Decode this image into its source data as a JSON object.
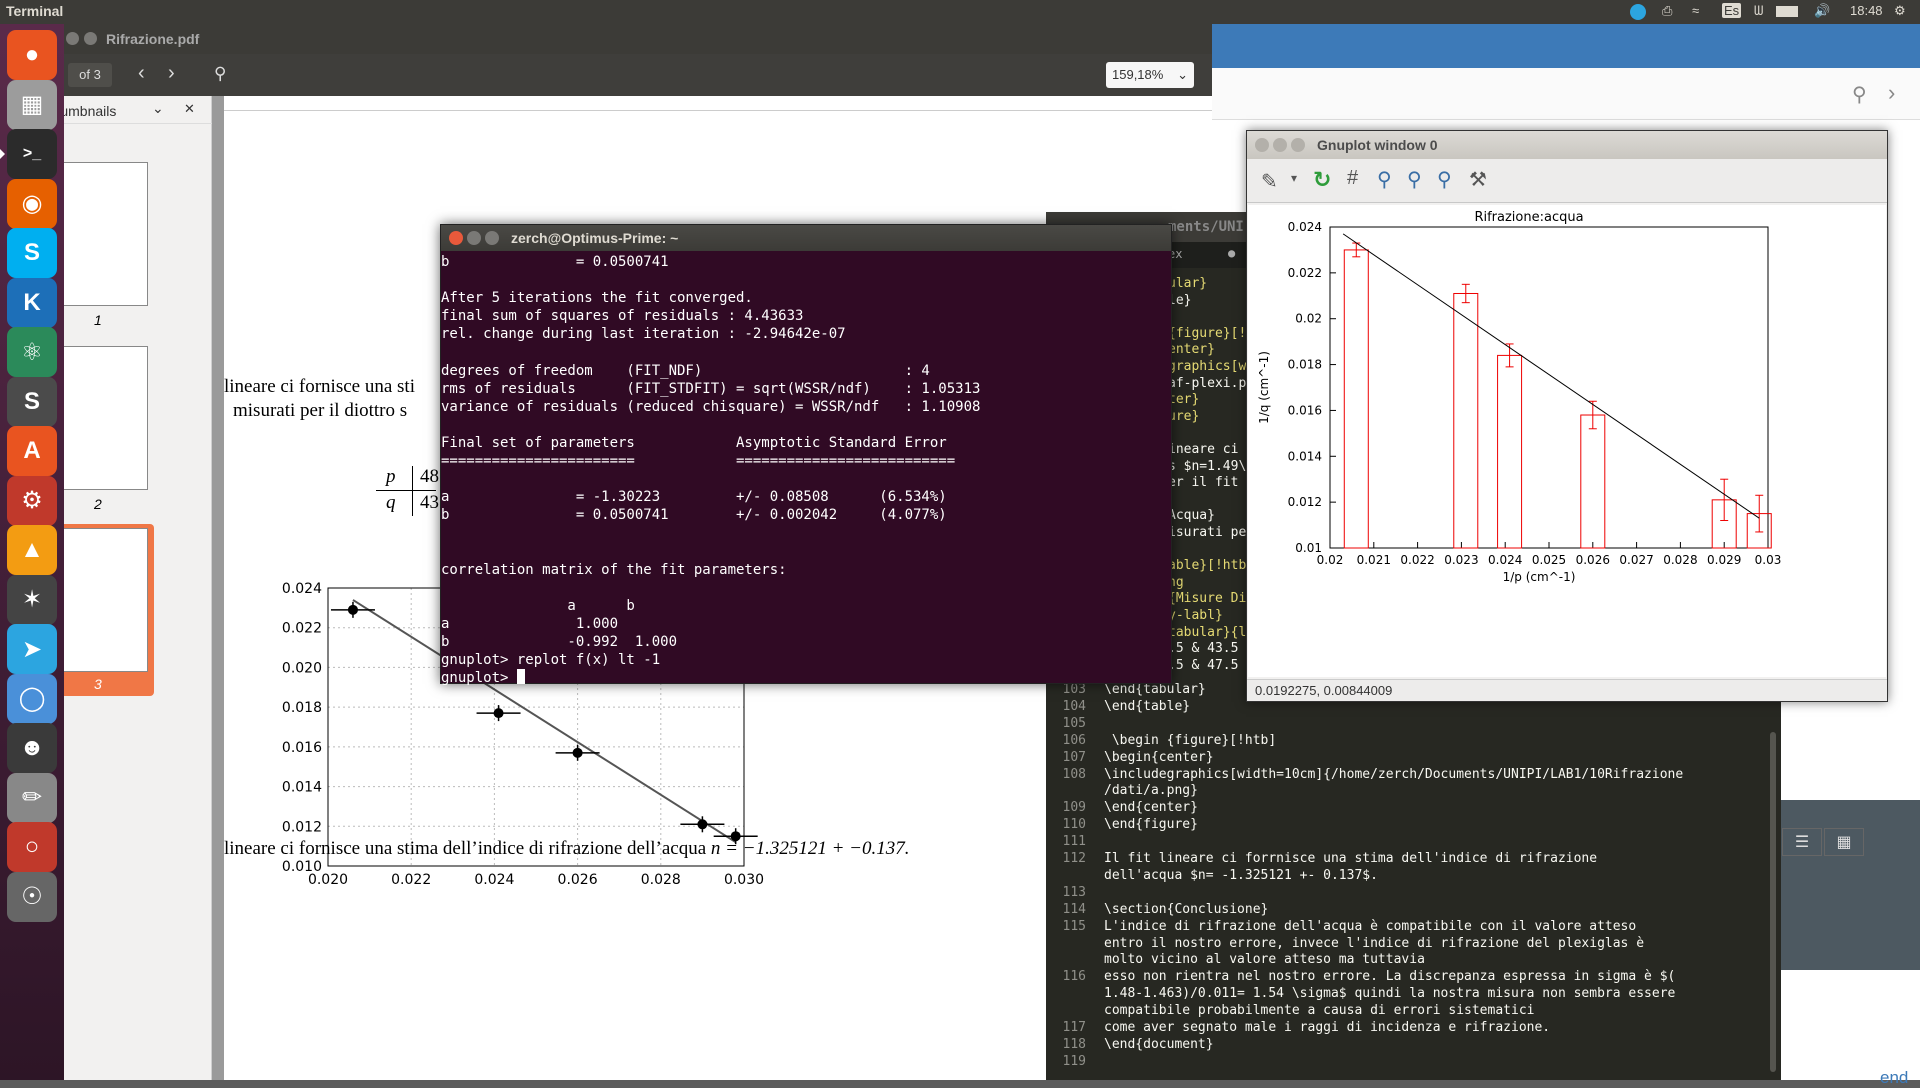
{
  "top_panel": {
    "app_title": "Terminal",
    "clock": "18:48",
    "keyboard": "Es"
  },
  "launcher": {
    "items": [
      "ubuntu-dash",
      "files",
      "terminal",
      "firefox",
      "skype",
      "kile",
      "atom",
      "sublime-text",
      "software-center",
      "system-settings",
      "vlc",
      "gnome-web-photo",
      "telegram",
      "chromium",
      "bug-buddy",
      "rubber",
      "evince",
      "disks"
    ]
  },
  "pdf_viewer": {
    "title": "Rifrazione.pdf",
    "page_of": "of 3",
    "zoom": "159,18%",
    "sidebar_label": "Thumbnails",
    "thumb_numbers": [
      "1",
      "2",
      "3"
    ],
    "text_line1": "lineare ci fornisce una sti",
    "text_line2": "misurati per il diottro s",
    "table_p": "p",
    "table_q": "q",
    "table_p_val": "48",
    "table_q_val": "43",
    "bottom_text_prefix": "lineare ci fornisce una stima dell’indice di rifrazione dell’acqua ",
    "bottom_text_math": "n = −1.325121 + −0.137.",
    "chart_yticks": [
      "0.024",
      "0.022",
      "0.020",
      "0.018",
      "0.016",
      "0.014",
      "0.012",
      "0.010"
    ],
    "chart_xticks": [
      "0.020",
      "0.022",
      "0.024",
      "0.026",
      "0.028",
      "0.030"
    ]
  },
  "terminal": {
    "title": "zerch@Optimus-Prime: ~",
    "lines": [
      "b               = 0.0500741",
      "",
      "After 5 iterations the fit converged.",
      "final sum of squares of residuals : 4.43633",
      "rel. change during last iteration : -2.94642e-07",
      "",
      "degrees of freedom    (FIT_NDF)                        : 4",
      "rms of residuals      (FIT_STDFIT) = sqrt(WSSR/ndf)    : 1.05313",
      "variance of residuals (reduced chisquare) = WSSR/ndf   : 1.10908",
      "",
      "Final set of parameters            Asymptotic Standard Error",
      "=======================            ==========================",
      "",
      "a               = -1.30223         +/- 0.08508      (6.534%)",
      "b               = 0.0500741        +/- 0.002042     (4.077%)",
      "",
      "",
      "correlation matrix of the fit parameters:",
      "",
      "               a      b",
      "a               1.000",
      "b              -0.992  1.000",
      "gnuplot> replot f(x) lt -1",
      "gnuplot> "
    ]
  },
  "gnuplot": {
    "title": "Gnuplot window 0",
    "status": "0.0192275, 0.00844009",
    "plot_title": "Rifrazione:acqua",
    "xlabel": "1/p (cm^-1)",
    "ylabel": "1/q (cm^-1)",
    "xticks": [
      "0.02",
      "0.021",
      "0.022",
      "0.023",
      "0.024",
      "0.025",
      "0.026",
      "0.027",
      "0.028",
      "0.029",
      "0.03"
    ],
    "yticks": [
      "0.024",
      "0.022",
      "0.02",
      "0.018",
      "0.016",
      "0.014",
      "0.012",
      "0.01"
    ]
  },
  "editor": {
    "tab_label": "ments/UNI",
    "tab2": "ex",
    "right_fragments": [
      "ular}",
      "le}",
      "",
      "{figure}[!",
      "enter}",
      "graphics[w",
      "af-plexi.p",
      "ter}",
      "ure}",
      "",
      "ineare ci",
      "s $n=1.49\\",
      "er il fit",
      "",
      "Acqua}",
      "isurati pe",
      "",
      "able}[!htb",
      "ng",
      "{Misure Di",
      "y-labl}",
      "tabular}{l|",
      ".5 & 43.5",
      ".5 & 47.5"
    ],
    "lines": [
      {
        "n": "103",
        "t": "\\end{tabular}"
      },
      {
        "n": "104",
        "t": "\\end{table}"
      },
      {
        "n": "105",
        "t": ""
      },
      {
        "n": "106",
        "t": " \\begin {figure}[!htb]"
      },
      {
        "n": "107",
        "t": "\\begin{center}"
      },
      {
        "n": "108",
        "t": "\\includegraphics[width=10cm]{/home/zerch/Documents/UNIPI/LAB1/10Rifrazione"
      },
      {
        "n": "",
        "t": "/dati/a.png}"
      },
      {
        "n": "109",
        "t": "\\end{center}"
      },
      {
        "n": "110",
        "t": "\\end{figure}"
      },
      {
        "n": "111",
        "t": ""
      },
      {
        "n": "112",
        "t": "Il fit lineare ci forrnisce una stima dell'indice di rifrazione"
      },
      {
        "n": "",
        "t": "dell'acqua $n= -1.325121 +- 0.137$."
      },
      {
        "n": "113",
        "t": ""
      },
      {
        "n": "114",
        "t": "\\section{Conclusione}"
      },
      {
        "n": "115",
        "t": "L'indice di rifrazione dell'acqua è compatibile con il valore atteso"
      },
      {
        "n": "",
        "t": "entro il nostro errore, invece l'indice di rifrazione del plexiglas è"
      },
      {
        "n": "",
        "t": "molto vicino al valore atteso ma tuttavia"
      },
      {
        "n": "116",
        "t": "esso non rientra nel nostro errore. La discrepanza espressa in sigma è $("
      },
      {
        "n": "",
        "t": "1.48-1.463)/0.011= 1.54 \\sigma$ quindi la nostra misura non sembra essere"
      },
      {
        "n": "",
        "t": "compatibile probabilmente a causa di errori sistematici"
      },
      {
        "n": "117",
        "t": "come aver segnato male i raggi di incidenza e rifrazione."
      },
      {
        "n": "118",
        "t": "\\end{document}"
      },
      {
        "n": "119",
        "t": ""
      }
    ]
  },
  "browser": {
    "footer_fragment": "end"
  },
  "chart_data": [
    {
      "type": "scatter",
      "title": "",
      "xlabel": "",
      "ylabel": "",
      "xlim": [
        0.02,
        0.03
      ],
      "ylim": [
        0.01,
        0.024
      ],
      "grid": true,
      "x": [
        0.0206,
        0.0241,
        0.026,
        0.029,
        0.0298
      ],
      "y": [
        0.0229,
        0.0177,
        0.0157,
        0.0121,
        0.0115
      ],
      "fit_line": {
        "x": [
          0.0206,
          0.0298
        ],
        "y": [
          0.0234,
          0.0112
        ]
      }
    },
    {
      "type": "bar",
      "title": "Rifrazione:acqua",
      "xlabel": "1/p (cm^-1)",
      "ylabel": "1/q (cm^-1)",
      "xlim": [
        0.02,
        0.03
      ],
      "ylim": [
        0.01,
        0.024
      ],
      "x": [
        0.0206,
        0.0231,
        0.0241,
        0.026,
        0.029,
        0.0298
      ],
      "y": [
        0.023,
        0.0211,
        0.0184,
        0.0158,
        0.0121,
        0.0115
      ],
      "err": [
        0.0003,
        0.0004,
        0.0005,
        0.0006,
        0.0009,
        0.0008
      ],
      "fit_line": {
        "x": [
          0.0203,
          0.0298
        ],
        "y": [
          0.0237,
          0.0113
        ]
      }
    }
  ]
}
